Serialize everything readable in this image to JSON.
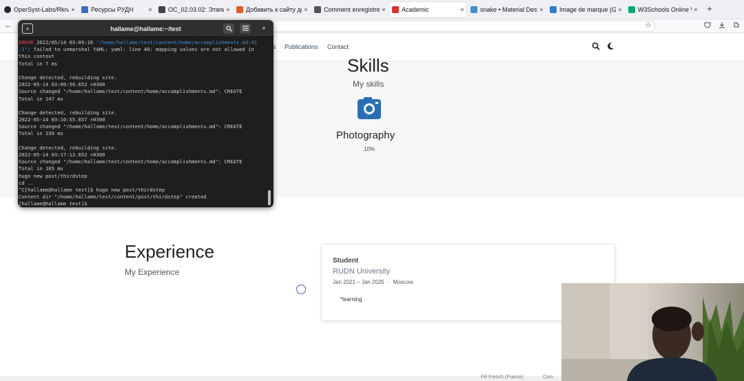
{
  "browser": {
    "tabs": [
      {
        "label": "OperSyst-Labs/RknA...",
        "icon_color": "#24292e",
        "icon_name": "github-icon"
      },
      {
        "label": "Ресурсы РУДН",
        "icon_color": "#3d6fbf",
        "icon_name": "site-icon"
      },
      {
        "label": "OC_02.03.02: Этапы...",
        "icon_color": "#444444",
        "icon_name": "site-icon"
      },
      {
        "label": "Добавить к сайту до...",
        "icon_color": "#e05a2b",
        "icon_name": "site-icon"
      },
      {
        "label": "Comment enregistrer",
        "icon_color": "#555555",
        "icon_name": "site-icon"
      },
      {
        "label": "Academic",
        "icon_color": "#e0312f",
        "icon_name": "academic-icon"
      },
      {
        "label": "snake • Material Desi...",
        "icon_color": "#3b8fd5",
        "icon_name": "site-icon"
      },
      {
        "label": "Image de marque (Gu...",
        "icon_color": "#2a7dd1",
        "icon_name": "site-icon"
      },
      {
        "label": "W3Schools Online We...",
        "icon_color": "#04aa6d",
        "icon_name": "w3-icon"
      }
    ],
    "active_tab_index": 5,
    "close_glyph": "×",
    "new_tab_glyph": "+",
    "back_glyph": "←",
    "star_glyph": "☆"
  },
  "site": {
    "nav_links": [
      "s",
      "Publications",
      "Contact"
    ],
    "search_glyph": "⚲",
    "theme_glyph": "☾"
  },
  "skills": {
    "title": "Skills",
    "subtitle": "My skills",
    "item_name": "Photography",
    "item_percent": "10%",
    "icon_color": "#2a6fb6"
  },
  "experience": {
    "title": "Experience",
    "subtitle": "My Experience",
    "card": {
      "role": "Student",
      "organization": "RUDN University",
      "dates": "Jan 2021 – Jan 2025",
      "separator": "·",
      "location": "Moscow",
      "description": "*learning"
    }
  },
  "footer": {
    "language": "FR French (France)",
    "other": "Com"
  },
  "terminal": {
    "title": "hallame@hallame:~/test",
    "lines": [
      [
        {
          "t": "ERROR",
          "c": "err"
        },
        {
          "t": " 2022/05/14 03:09:16 ",
          "c": ""
        },
        {
          "t": "\"/home/hallame/test/content/home/accomplishments.md:41",
          "c": "path"
        }
      ],
      [
        {
          "t": ":1\"",
          "c": "path"
        },
        {
          "t": ": failed to unmarshal YAML: yaml: line 40: mapping values are not allowed in",
          "c": ""
        }
      ],
      [
        {
          "t": "this context",
          "c": ""
        }
      ],
      [
        {
          "t": "Total in 7 ms",
          "c": ""
        }
      ],
      [
        {
          "t": "",
          "c": ""
        }
      ],
      [
        {
          "t": "Change detected, rebuilding site.",
          "c": ""
        }
      ],
      [
        {
          "t": "2022-05-14 03:09:59.652 +0300",
          "c": ""
        }
      ],
      [
        {
          "t": "Source changed \"/home/hallame/test/content/home/accomplishments.md\": CREATE",
          "c": ""
        }
      ],
      [
        {
          "t": "Total in 247 ms",
          "c": ""
        }
      ],
      [
        {
          "t": "",
          "c": ""
        }
      ],
      [
        {
          "t": "Change detected, rebuilding site.",
          "c": ""
        }
      ],
      [
        {
          "t": "2022-05-14 03:10:55.657 +0300",
          "c": ""
        }
      ],
      [
        {
          "t": "Source changed \"/home/hallame/test/content/home/accomplishments.md\": CREATE",
          "c": ""
        }
      ],
      [
        {
          "t": "Total in 239 ms",
          "c": ""
        }
      ],
      [
        {
          "t": "",
          "c": ""
        }
      ],
      [
        {
          "t": "Change detected, rebuilding site.",
          "c": ""
        }
      ],
      [
        {
          "t": "2022-05-14 03:17:13.652 +0300",
          "c": ""
        }
      ],
      [
        {
          "t": "Source changed \"/home/hallame/test/content/home/accomplishments.md\": CREATE",
          "c": ""
        }
      ],
      [
        {
          "t": "Total in 165 ms",
          "c": ""
        }
      ],
      [
        {
          "t": "hugo new post/thirdstep",
          "c": ""
        }
      ],
      [
        {
          "t": "cd ..",
          "c": ""
        }
      ],
      [
        {
          "t": "^C[hallame@hallame test]$ hugo new post/thirdstep",
          "c": ""
        }
      ],
      [
        {
          "t": "Content dir \"/home/hallame/test/content/post/thirdstep\" created",
          "c": ""
        }
      ],
      [
        {
          "t": "[hallame@hallame test]$ ",
          "c": ""
        }
      ]
    ]
  }
}
